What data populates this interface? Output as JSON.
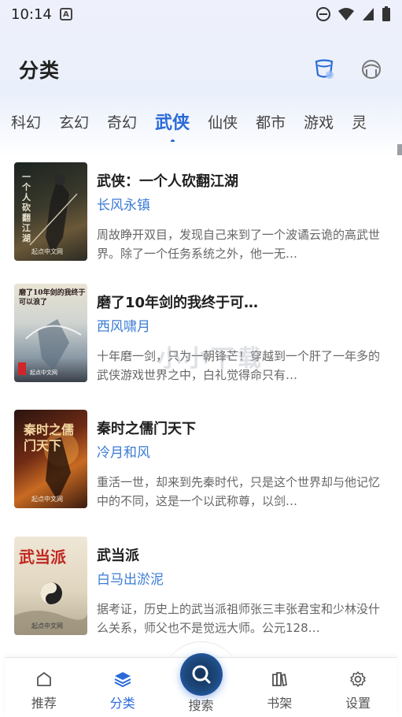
{
  "status": {
    "time": "10:14",
    "notification_letter": "A"
  },
  "header": {
    "title": "分类"
  },
  "tabs": [
    {
      "label": "科幻",
      "active": false
    },
    {
      "label": "玄幻",
      "active": false
    },
    {
      "label": "奇幻",
      "active": false
    },
    {
      "label": "武侠",
      "active": true
    },
    {
      "label": "仙侠",
      "active": false
    },
    {
      "label": "都市",
      "active": false
    },
    {
      "label": "游戏",
      "active": false
    },
    {
      "label": "灵",
      "active": false
    }
  ],
  "books": [
    {
      "title": "武侠：一个人砍翻江湖",
      "author": "长风永镇",
      "description": "周故睁开双目，发现自己来到了一个波谲云诡的高武世界。除了一个任务系统之外，他一无…",
      "cover_text": "一个人砍翻江湖",
      "cover_publisher": "起点中文网"
    },
    {
      "title": "磨了10年剑的我终于可…",
      "author": "西风啸月",
      "description": "十年磨一剑，只为一朝锋芒！穿越到一个肝了一年多的武侠游戏世界之中，白礼觉得命只有…",
      "cover_text": "磨了10年剑的我终于可以浪了",
      "cover_publisher": "起点中文网"
    },
    {
      "title": "秦时之儒门天下",
      "author": "冷月和风",
      "description": "重活一世，却来到先秦时代，只是这个世界却与他记忆中的不同，这是一个以武称尊，以剑…",
      "cover_text": "秦时之儒门天下",
      "cover_publisher": "起点中文网"
    },
    {
      "title": "武当派",
      "author": "白马出淤泥",
      "description": "据考证，历史上的武当派祖师张三丰张君宝和少林没什么关系，师父也不是觉远大师。公元128…",
      "cover_text": "武当派",
      "cover_publisher": "起点中文网"
    }
  ],
  "watermark": "小小下载",
  "bottom_nav": {
    "recommend": "推荐",
    "category": "分类",
    "search": "搜索",
    "bookshelf": "书架",
    "settings": "设置"
  },
  "colors": {
    "accent": "#2a6ad8",
    "author": "#3a7bd5"
  }
}
